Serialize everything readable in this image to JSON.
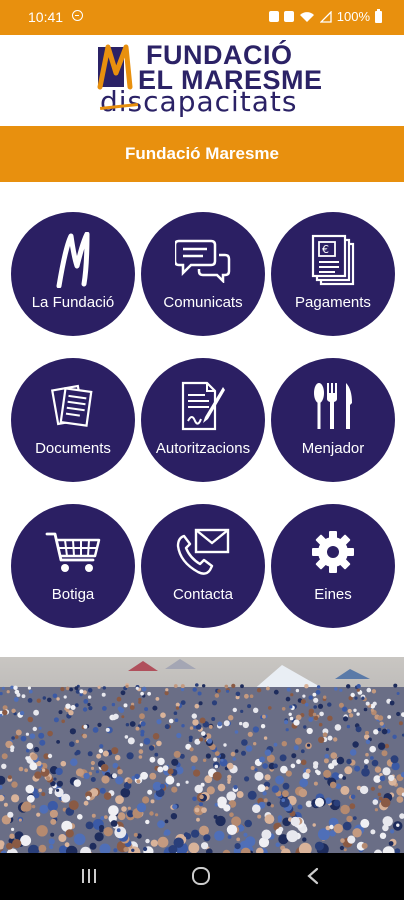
{
  "status_bar": {
    "time": "10:41",
    "battery": "100%"
  },
  "logo": {
    "line1": "FUNDACIÓ",
    "line2": "EL MARESME",
    "line3": "discapacitats"
  },
  "title_bar": {
    "title": "Fundació Maresme"
  },
  "menu": [
    {
      "label": "La Fundació",
      "icon": "m-logo-icon"
    },
    {
      "label": "Comunicats",
      "icon": "chat-bubbles-icon"
    },
    {
      "label": "Pagaments",
      "icon": "euro-documents-icon"
    },
    {
      "label": "Documents",
      "icon": "documents-icon"
    },
    {
      "label": "Autoritzacions",
      "icon": "document-sign-icon"
    },
    {
      "label": "Menjador",
      "icon": "cutlery-icon"
    },
    {
      "label": "Botiga",
      "icon": "shopping-cart-icon"
    },
    {
      "label": "Contacta",
      "icon": "phone-mail-icon"
    },
    {
      "label": "Eines",
      "icon": "gear-icon"
    }
  ],
  "colors": {
    "accent": "#e8900e",
    "tile": "#2b1f63",
    "brand": "#2b2266"
  }
}
